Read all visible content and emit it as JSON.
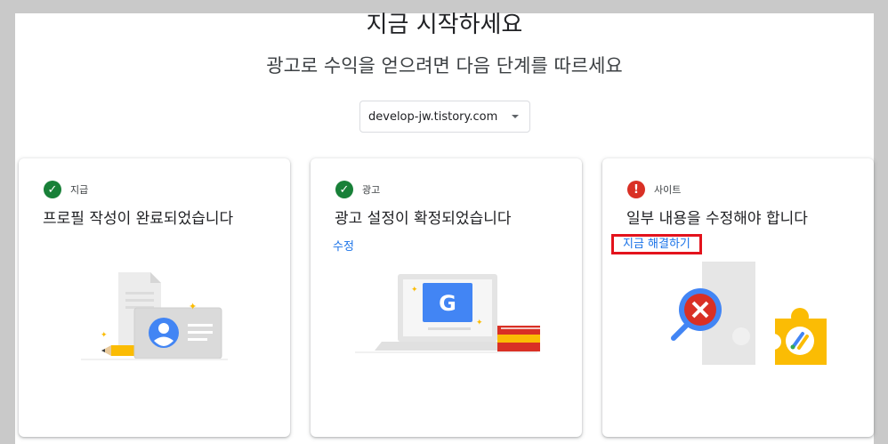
{
  "header": {
    "title": "지금 시작하세요",
    "subtitle": "광고로 수익을 얻으려면 다음 단계를 따르세요"
  },
  "site_selector": {
    "value": "develop-jw.tistory.com"
  },
  "cards": [
    {
      "category": "지급",
      "status": "complete",
      "heading": "프로필 작성이 완료되었습니다",
      "link": ""
    },
    {
      "category": "광고",
      "status": "complete",
      "heading": "광고 설정이 확정되었습니다",
      "link": "수정"
    },
    {
      "category": "사이트",
      "status": "error",
      "heading": "일부 내용을 수정해야 합니다",
      "link": "지금 해결하기"
    }
  ],
  "colors": {
    "success": "#188038",
    "error": "#d93025",
    "link": "#1a73e8",
    "highlight_box": "#e3131c",
    "google_blue": "#4285f4",
    "google_yellow": "#fbbc04"
  },
  "icons": {
    "complete": "check-circle-icon",
    "error": "error-circle-icon",
    "dropdown": "caret-down-icon"
  }
}
